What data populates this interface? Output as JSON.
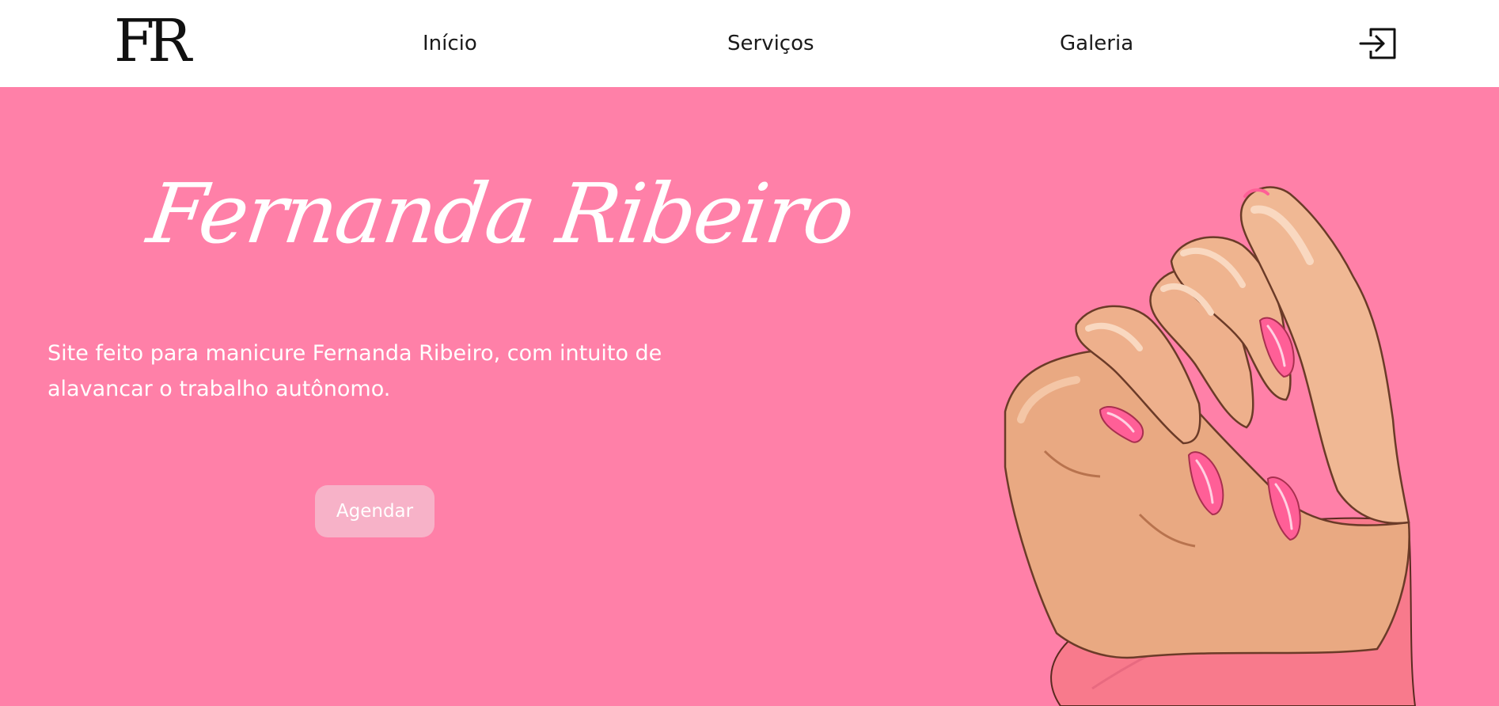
{
  "header": {
    "logo_text": "FR",
    "nav": {
      "inicio": "Início",
      "servicos": "Serviços",
      "galeria": "Galeria"
    },
    "login_icon": "login-icon"
  },
  "hero": {
    "title": "Fernanda Ribeiro",
    "description": "Site feito para manicure Fernanda Ribeiro, com intuito de alavancar o trabalho autônomo.",
    "cta_label": "Agendar",
    "illustration": "hand-with-pink-nails"
  },
  "colors": {
    "background": "#ff80a8",
    "header_bg": "#ffffff",
    "button_bg": "#f7b2c8",
    "text_light": "#ffffff",
    "text_dark": "#1a1a1a"
  }
}
